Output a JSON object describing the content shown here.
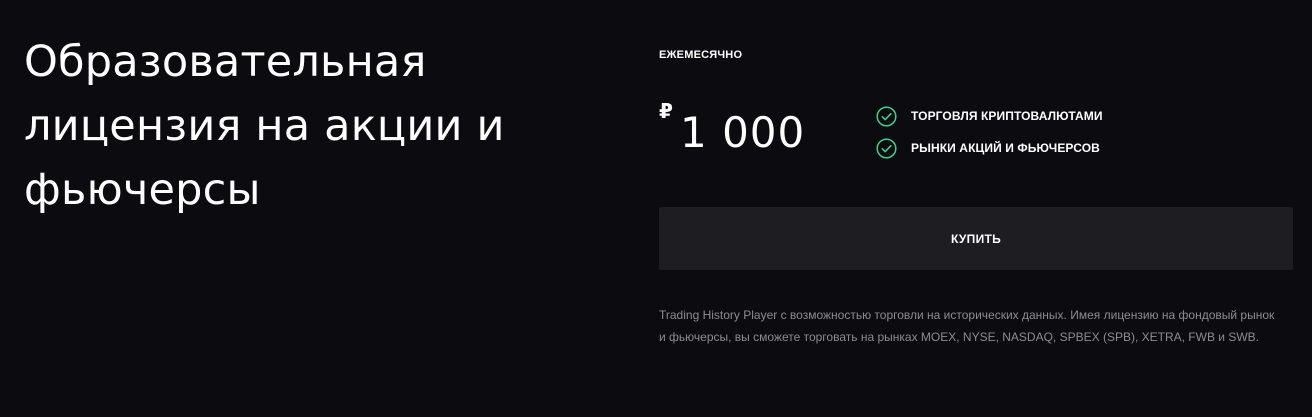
{
  "product": {
    "title": "Образовательная лицензия на акции и фьючерсы"
  },
  "pricing": {
    "period": "ЕЖЕМЕСЯЧНО",
    "currency_symbol": "₽",
    "amount": "1 000"
  },
  "features": [
    {
      "icon": "check-circle-icon",
      "label": "ТОРГОВЛЯ КРИПТОВАЛЮТАМИ"
    },
    {
      "icon": "check-circle-icon",
      "label": "РЫНКИ АКЦИЙ И ФЬЮЧЕРСОВ"
    }
  ],
  "actions": {
    "buy_label": "КУПИТЬ"
  },
  "description": "Trading History Player с возможностью торговли на исторических данных. Имея лицензию на фондовый рынок и фьючерсы, вы сможете торговать на рынках MOEX, NYSE, NASDAQ, SPBEX (SPB), XETRA, FWB и SWB.",
  "colors": {
    "background": "#0c0b10",
    "check_accent": "#3ecf8e",
    "button_bg": "#1e1d22",
    "muted_text": "#8d8c91"
  }
}
